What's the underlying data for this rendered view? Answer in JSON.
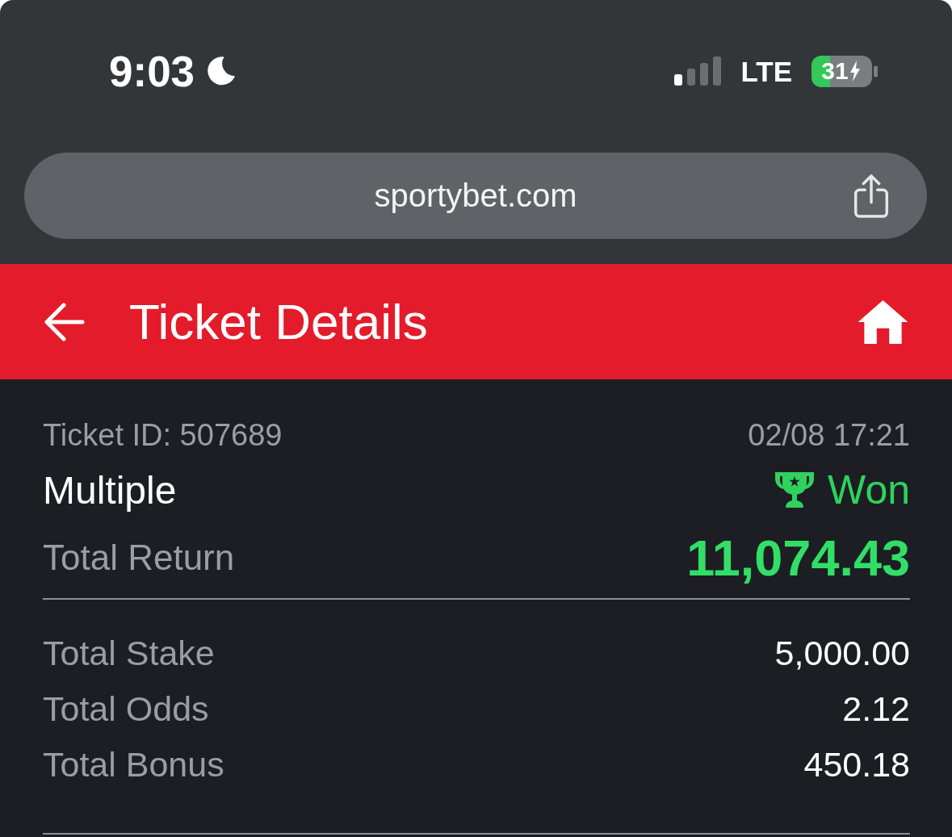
{
  "status_bar": {
    "time": "9:03",
    "network": "LTE",
    "battery": "31"
  },
  "address_bar": {
    "url": "sportybet.com"
  },
  "header": {
    "title": "Ticket Details"
  },
  "ticket": {
    "id": "Ticket ID: 507689",
    "date": "02/08 17:21",
    "type": "Multiple",
    "status": "Won",
    "return_label": "Total Return",
    "return_value": "11,074.43"
  },
  "summary": [
    {
      "label": "Total Stake",
      "value": "5,000.00"
    },
    {
      "label": "Total Odds",
      "value": "2.12"
    },
    {
      "label": "Total Bonus",
      "value": "450.18"
    }
  ]
}
